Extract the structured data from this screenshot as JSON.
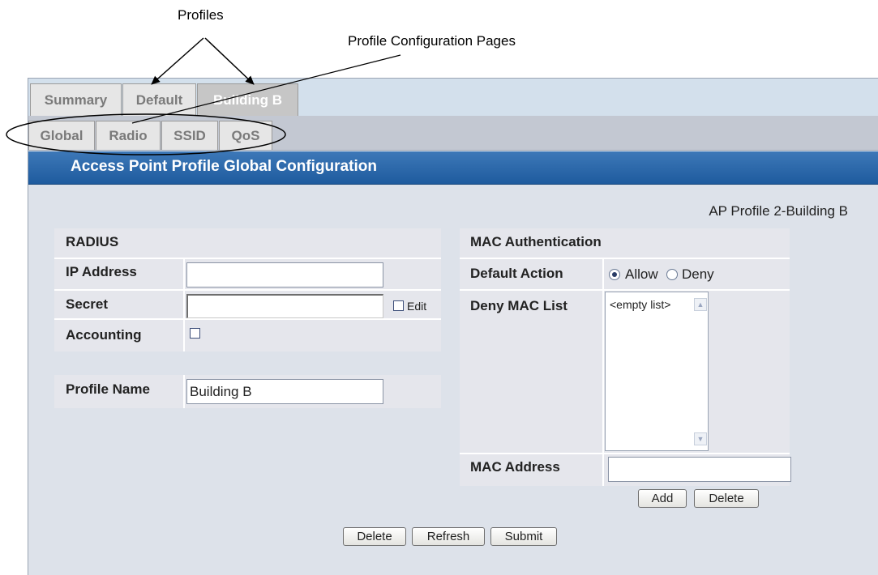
{
  "annotations": {
    "profiles": "Profiles",
    "profile_config_pages": "Profile Configuration Pages"
  },
  "profile_tabs": [
    {
      "label": "Summary",
      "active": false
    },
    {
      "label": "Default",
      "active": false
    },
    {
      "label": "Building B",
      "active": true
    }
  ],
  "config_tabs": [
    {
      "label": "Global"
    },
    {
      "label": "Radio"
    },
    {
      "label": "SSID"
    },
    {
      "label": "QoS"
    }
  ],
  "page_title": "Access Point Profile Global Configuration",
  "ap_profile_name": "AP Profile 2-Building B",
  "radius": {
    "heading": "RADIUS",
    "ip_label": "IP Address",
    "ip_value": "",
    "secret_label": "Secret",
    "secret_value": "",
    "edit_label": "Edit",
    "edit_checked": false,
    "accounting_label": "Accounting",
    "accounting_checked": false
  },
  "profile": {
    "name_label": "Profile Name",
    "name_value": "Building B"
  },
  "mac_auth": {
    "heading": "MAC Authentication",
    "default_action_label": "Default Action",
    "allow_label": "Allow",
    "deny_label": "Deny",
    "selected": "Allow",
    "deny_list_label": "Deny MAC List",
    "deny_list_items": [
      "<empty list>"
    ],
    "mac_address_label": "MAC Address",
    "mac_address_value": "",
    "add_button": "Add",
    "delete_button": "Delete"
  },
  "footer_buttons": {
    "delete": "Delete",
    "refresh": "Refresh",
    "submit": "Submit"
  },
  "colors": {
    "title_bar": "#2a65a8",
    "active_tab": "#c6c6c6"
  }
}
